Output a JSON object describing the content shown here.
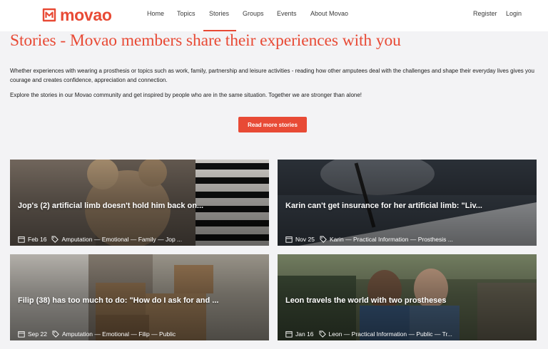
{
  "brand": {
    "name": "movao",
    "accent": "#e84a35"
  },
  "nav": {
    "items": [
      "Home",
      "Topics",
      "Stories",
      "Groups",
      "Events",
      "About Movao"
    ],
    "active": "Stories",
    "register": "Register",
    "login": "Login"
  },
  "intro": {
    "headline": "Stories - Movao members share their experiences with you",
    "paragraph1": "Whether experiences with wearing a prosthesis or topics such as work, family, partnership and leisure activities - reading how other amputees deal with the challenges and shape their everyday lives gives you courage and creates confidence, appreciation and connection.",
    "paragraph2": "Explore the stories in our Movao community and get inspired by people who are in the same situation. Together we are stronger than alone!",
    "button": "Read more stories"
  },
  "cards": [
    {
      "title": "Jop's (2) artificial limb doesn't hold him back on...",
      "date": "Feb 16",
      "tags": "Amputation — Emotional — Family — Jop ...",
      "icon": "teddy-bear-photo"
    },
    {
      "title": "Karin can't get insurance for her artificial limb: \"Liv...",
      "date": "Nov 25",
      "tags": "Karin — Practical Information — Prosthesis ...",
      "icon": "pen-writing-photo"
    },
    {
      "title": "Filip (38) has too much to do: \"How do I ask for and ...",
      "date": "Sep 22",
      "tags": "Amputation — Emotional — Filip — Public",
      "icon": "moving-boxes-photo"
    },
    {
      "title": "Leon travels the world with two prostheses",
      "date": "Jan 16",
      "tags": "Leon — Practical Information — Public — Tr...",
      "icon": "travelers-photo"
    }
  ]
}
